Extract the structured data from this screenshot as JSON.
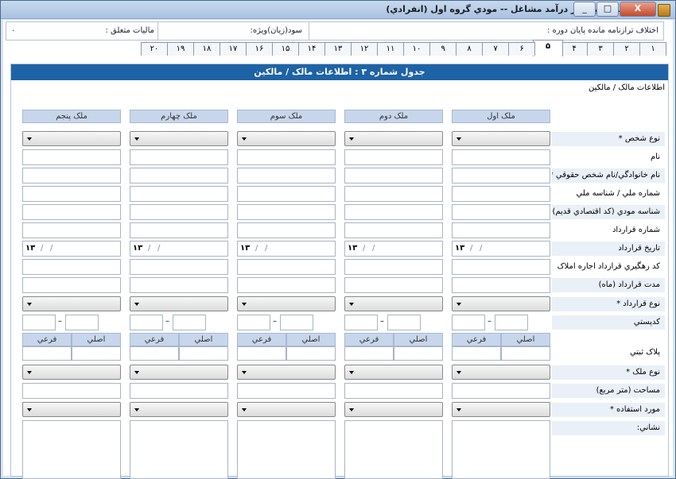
{
  "window": {
    "title": "اظهارنامه ماليات بر درآمد مشاغل -- مودي گروه اول (انفرادي)",
    "buttons": {
      "minimize": "_",
      "maximize": "□",
      "close": "X"
    }
  },
  "infobar": {
    "diff_label": "اختلاف ترازنامه مانده پایان دوره :",
    "profit_label": "سود(زيان)ويژه:",
    "tax_label": "ماليات متعلق :",
    "tax_value": "۰"
  },
  "tabs": [
    "۱",
    "۲",
    "۳",
    "۴",
    "۵",
    "۶",
    "۷",
    "۸",
    "۹",
    "۱۰",
    "۱۱",
    "۱۲",
    "۱۳",
    "۱۴",
    "۱۵",
    "۱۶",
    "۱۷",
    "۱۸",
    "۱۹",
    "۲۰"
  ],
  "active_tab": "۵",
  "panel": {
    "title": "جدول شماره ۳ : اطلاعات مالک / مالکين",
    "section_label": "اطلاعات مالک / مالکين"
  },
  "owners": [
    "ملک اول",
    "ملک دوم",
    "ملک سوم",
    "ملک چهارم",
    "ملک پنجم"
  ],
  "row_labels": {
    "person_type": "نوع شخص *",
    "name": "نام",
    "family": "نام خانوادگي/نام شخص حقوقي *",
    "national_id": "شماره ملي / شناسه ملي",
    "tax_id": "شناسه مودي (کد اقتصادي قديم)",
    "contract_no": "شماره قرارداد",
    "contract_date": "تاريخ قرارداد",
    "tracking_code": "کد رهگيري قرارداد اجاره املاک",
    "contract_duration": "مدت قرارداد (ماه)",
    "contract_type": "نوع قرارداد *",
    "postal_code": "کدپستي",
    "plaque": "پلاک ثبتي",
    "property_type": "نوع ملک *",
    "area": "مساحت (متر مربع)",
    "usage": "مورد استفاده *",
    "address": "نشاني:"
  },
  "plaque_sub": {
    "main": "اصلي",
    "sub": "فرعي"
  },
  "date_prefix": "۱۳"
}
